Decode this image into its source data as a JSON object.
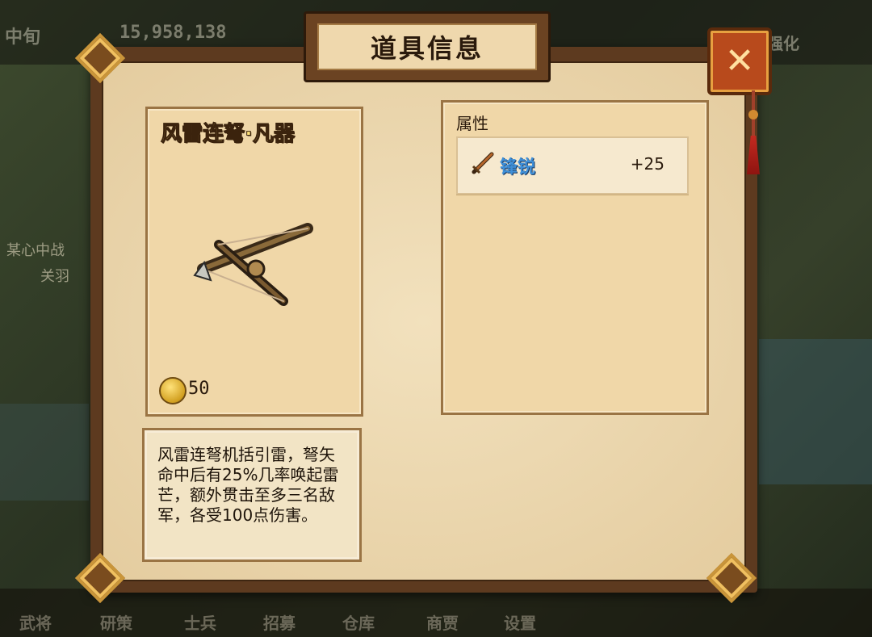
{
  "background": {
    "top_left_label": "中旬",
    "currency_amount": "15,958,138",
    "top_right_label": "强化",
    "side_label_1": "某心中战",
    "side_label_2": "关羽",
    "nav": [
      "武将",
      "研策",
      "士兵",
      "招募",
      "仓库",
      "商贾",
      "设置"
    ]
  },
  "dialog": {
    "title": "道具信息",
    "close_label": "✕"
  },
  "item": {
    "name": "风雷连弩·凡器",
    "icon": "crossbow-icon",
    "price": "50",
    "description": "风雷连弩机括引雷，弩矢命中后有25%几率唤起雷芒，额外贯击至多三名敌军，各受100点伤害。"
  },
  "attributes": {
    "header": "属性",
    "rows": [
      {
        "icon": "sword-icon",
        "name": "锋锐",
        "value": "+25"
      }
    ]
  },
  "colors": {
    "frame": "#5d3a1f",
    "parchment": "#ecd8b0",
    "item_name": "#ffe27a",
    "attr_name": "#3e8fd8",
    "close_button": "#b84a1c"
  }
}
